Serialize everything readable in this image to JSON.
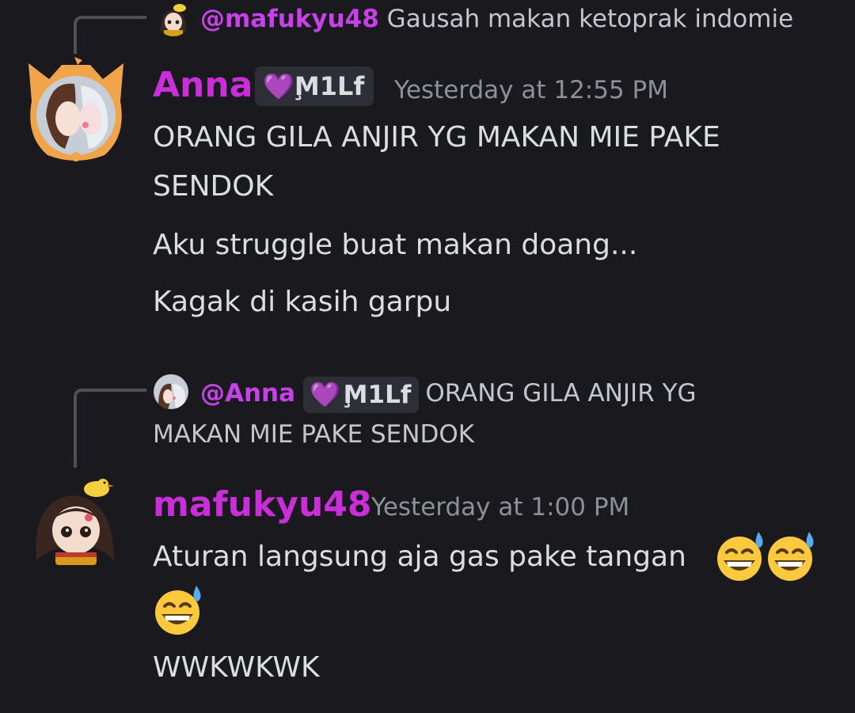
{
  "reply1": {
    "mention": "@mafukyu48",
    "text": "Gausah makan ketoprak indomie"
  },
  "msg1": {
    "username": "Anna",
    "tag": "M̧1Lf",
    "timestamp": "Yesterday at 12:55 PM",
    "lines": [
      "ORANG GILA ANJIR YG MAKAN MIE PAKE",
      "SENDOK",
      "Aku struggle buat makan doang...",
      "Kagak di kasih garpu"
    ]
  },
  "reply2": {
    "mention": "@Anna",
    "tag": "M̧1Lf",
    "text_line1": "ORANG GILA ANJIR YG",
    "text_line2": "MAKAN MIE PAKE SENDOK"
  },
  "msg2": {
    "username": "mafukyu48",
    "timestamp": "Yesterday at 1:00 PM",
    "line1": "Aturan langsung aja gas pake tangan",
    "line3": "WWKWKWK",
    "emoji": "grinning-sweat-emoji"
  },
  "colors": {
    "background": "#1a1a1e",
    "username": "#c92fd9",
    "mention": "#c642e8",
    "text": "#dbdee1",
    "muted": "#8e9097",
    "spine": "#4e5058",
    "tag_bg": "#2e2f36"
  }
}
